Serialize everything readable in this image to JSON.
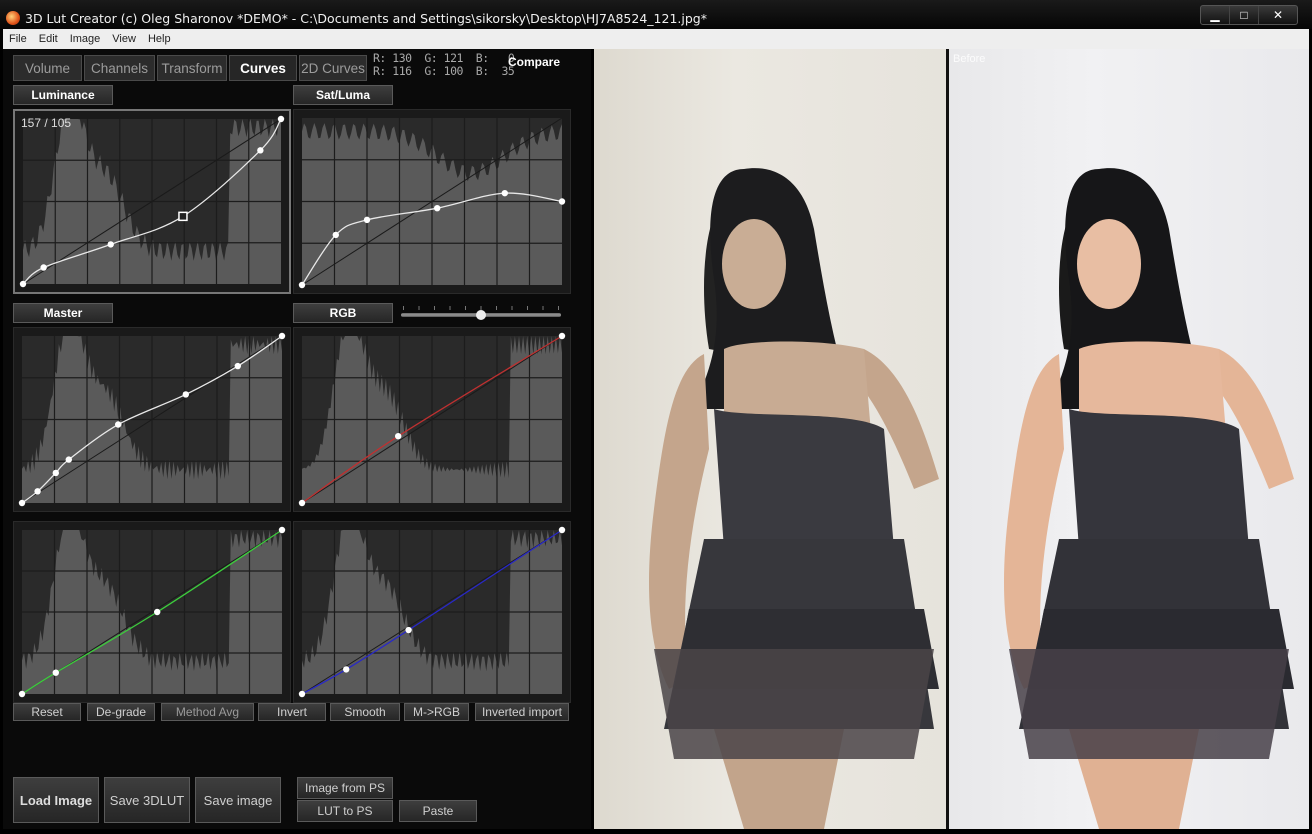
{
  "window": {
    "title": "3D Lut Creator (c) Oleg Sharonov *DEMO* - C:\\Documents and Settings\\sikorsky\\Desktop\\HJ7A8524_121.jpg*",
    "controls": {
      "minimize": "▁",
      "maximize": "□",
      "close": "✕"
    }
  },
  "menu": [
    "File",
    "Edit",
    "Image",
    "View",
    "Help"
  ],
  "tabs": [
    {
      "label": "Volume",
      "active": false
    },
    {
      "label": "Channels",
      "active": false
    },
    {
      "label": "Transform",
      "active": false
    },
    {
      "label": "Curves",
      "active": true
    },
    {
      "label": "2D Curves",
      "active": false
    }
  ],
  "readout": {
    "line1": "R: 130  G: 121  B:   0",
    "line2": "R: 116  G: 100  B:  35"
  },
  "compare_label": "Compare",
  "section_labels": {
    "luminance": "Luminance",
    "sat_luma": "Sat/Luma",
    "master": "Master",
    "rgb": "RGB"
  },
  "rgb_slider": {
    "value": 0.5
  },
  "luminance_coord": "157 / 105",
  "curves": {
    "luminance": {
      "color": "#e8e8e8",
      "points": [
        [
          0,
          0
        ],
        [
          0.08,
          0.1
        ],
        [
          0.34,
          0.24
        ],
        [
          0.62,
          0.41
        ],
        [
          0.92,
          0.81
        ],
        [
          1,
          1
        ]
      ],
      "selected_index": 3
    },
    "sat_luma": {
      "color": "#e8e8e8",
      "points": [
        [
          0,
          0
        ],
        [
          0.13,
          0.3
        ],
        [
          0.25,
          0.39
        ],
        [
          0.52,
          0.46
        ],
        [
          0.78,
          0.55
        ],
        [
          1,
          0.5
        ]
      ]
    },
    "master": {
      "color": "#e8e8e8",
      "points": [
        [
          0,
          0
        ],
        [
          0.06,
          0.07
        ],
        [
          0.13,
          0.18
        ],
        [
          0.18,
          0.26
        ],
        [
          0.37,
          0.47
        ],
        [
          0.63,
          0.65
        ],
        [
          0.83,
          0.82
        ],
        [
          1,
          1
        ]
      ]
    },
    "red": {
      "color": "#c03030",
      "points": [
        [
          0,
          0
        ],
        [
          0.37,
          0.4
        ],
        [
          1,
          1
        ]
      ]
    },
    "green": {
      "color": "#3ccc3c",
      "points": [
        [
          0,
          0
        ],
        [
          0.13,
          0.13
        ],
        [
          0.52,
          0.5
        ],
        [
          1,
          1
        ]
      ]
    },
    "blue": {
      "color": "#2828c8",
      "points": [
        [
          0,
          0
        ],
        [
          0.17,
          0.15
        ],
        [
          0.41,
          0.39
        ],
        [
          1,
          1
        ]
      ]
    }
  },
  "curve_buttons": [
    "Reset",
    "De-grade",
    "Method Avg",
    "Invert",
    "Smooth",
    "M->RGB",
    "Inverted import"
  ],
  "bottom_buttons": {
    "load_image": "Load Image",
    "save_3dlut": "Save 3DLUT",
    "save_image": "Save image",
    "image_from_ps": "Image from PS",
    "lut_to_ps": "LUT to PS",
    "paste": "Paste"
  },
  "preview": {
    "before_label": "Before"
  }
}
